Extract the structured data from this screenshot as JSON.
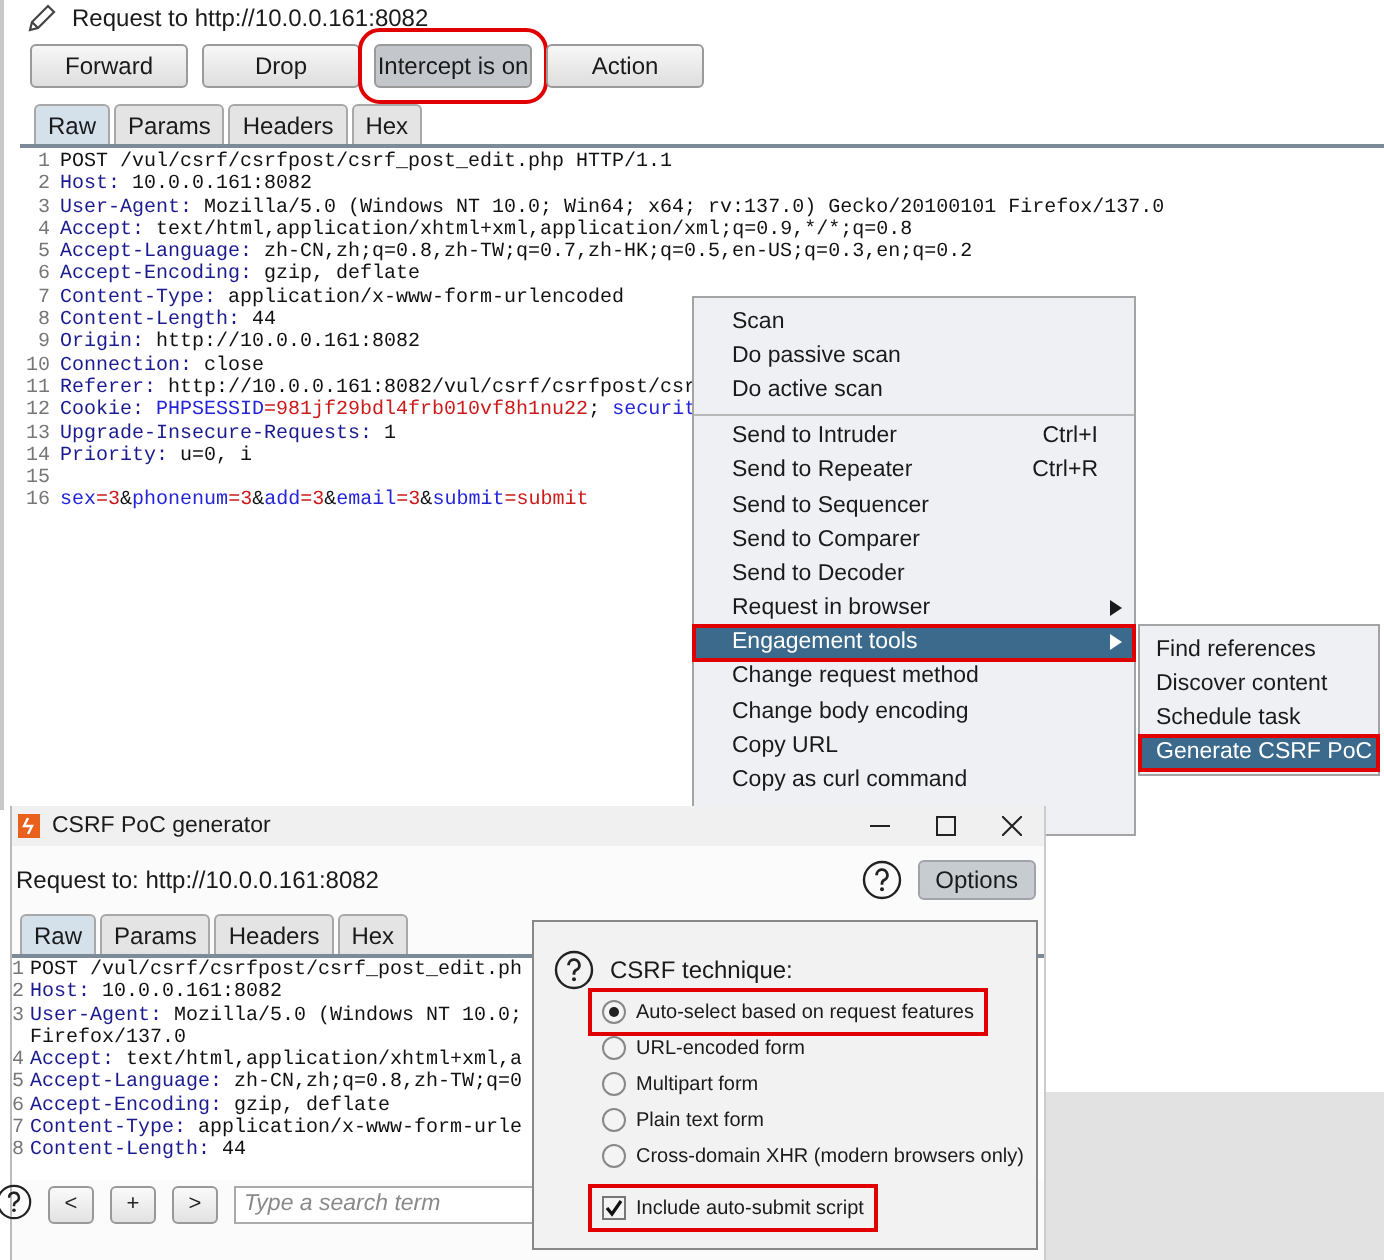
{
  "request_panel": {
    "title": "Request to http://10.0.0.161:8082",
    "buttons": [
      {
        "label": "Forward",
        "pressed": false,
        "annotated": false
      },
      {
        "label": "Drop",
        "pressed": false,
        "annotated": false
      },
      {
        "label": "Intercept is on",
        "pressed": true,
        "annotated": true
      },
      {
        "label": "Action",
        "pressed": false,
        "annotated": false
      }
    ],
    "tabs": [
      {
        "label": "Raw",
        "selected": true
      },
      {
        "label": "Params",
        "selected": false
      },
      {
        "label": "Headers",
        "selected": false
      },
      {
        "label": "Hex",
        "selected": false
      }
    ],
    "lines": [
      {
        "number": "1",
        "segments": [
          {
            "kind": "plain",
            "text": "POST /vul/csrf/csrfpost/csrf_post_edit.php HTTP/1.1"
          }
        ]
      },
      {
        "number": "2",
        "segments": [
          {
            "kind": "name",
            "text": "Host:"
          },
          {
            "kind": "plain",
            "text": " 10.0.0.161:8082"
          }
        ]
      },
      {
        "number": "3",
        "segments": [
          {
            "kind": "name",
            "text": "User-Agent:"
          },
          {
            "kind": "plain",
            "text": " Mozilla/5.0 (Windows NT 10.0; Win64; x64; rv:137.0) Gecko/20100101 Firefox/137.0"
          }
        ]
      },
      {
        "number": "4",
        "segments": [
          {
            "kind": "name",
            "text": "Accept:"
          },
          {
            "kind": "plain",
            "text": " text/html,application/xhtml+xml,application/xml;q=0.9,*/*;q=0.8"
          }
        ]
      },
      {
        "number": "5",
        "segments": [
          {
            "kind": "name",
            "text": "Accept-Language:"
          },
          {
            "kind": "plain",
            "text": " zh-CN,zh;q=0.8,zh-TW;q=0.7,zh-HK;q=0.5,en-US;q=0.3,en;q=0.2"
          }
        ]
      },
      {
        "number": "6",
        "segments": [
          {
            "kind": "name",
            "text": "Accept-Encoding:"
          },
          {
            "kind": "plain",
            "text": " gzip, deflate"
          }
        ]
      },
      {
        "number": "7",
        "segments": [
          {
            "kind": "name",
            "text": "Content-Type:"
          },
          {
            "kind": "plain",
            "text": " application/x-www-form-urlencoded"
          }
        ]
      },
      {
        "number": "8",
        "segments": [
          {
            "kind": "name",
            "text": "Content-Length:"
          },
          {
            "kind": "plain",
            "text": " 44"
          }
        ]
      },
      {
        "number": "9",
        "segments": [
          {
            "kind": "name",
            "text": "Origin:"
          },
          {
            "kind": "plain",
            "text": " http://10.0.0.161:8082"
          }
        ]
      },
      {
        "number": "10",
        "segments": [
          {
            "kind": "name",
            "text": "Connection:"
          },
          {
            "kind": "plain",
            "text": " close"
          }
        ]
      },
      {
        "number": "11",
        "segments": [
          {
            "kind": "name",
            "text": "Referer:"
          },
          {
            "kind": "plain",
            "text": " http://10.0.0.161:8082/vul/csrf/csrfpost/csr"
          }
        ]
      },
      {
        "number": "12",
        "segments": [
          {
            "kind": "name",
            "text": "Cookie: "
          },
          {
            "kind": "param",
            "text": "PHPSESSID"
          },
          {
            "kind": "value",
            "text": "=981jf29bdl4frb010vf8h1nu22"
          },
          {
            "kind": "plain",
            "text": "; "
          },
          {
            "kind": "param",
            "text": "securit"
          }
        ]
      },
      {
        "number": "13",
        "segments": [
          {
            "kind": "name",
            "text": "Upgrade-Insecure-Requests:"
          },
          {
            "kind": "plain",
            "text": " 1"
          }
        ]
      },
      {
        "number": "14",
        "segments": [
          {
            "kind": "name",
            "text": "Priority:"
          },
          {
            "kind": "plain",
            "text": " u=0, i"
          }
        ]
      },
      {
        "number": "15"
      },
      {
        "number": "16",
        "segments": [
          {
            "kind": "param",
            "text": "sex"
          },
          {
            "kind": "value",
            "text": "=3"
          },
          {
            "kind": "plain",
            "text": "&"
          },
          {
            "kind": "param",
            "text": "phonenum"
          },
          {
            "kind": "value",
            "text": "=3"
          },
          {
            "kind": "plain",
            "text": "&"
          },
          {
            "kind": "param",
            "text": "add"
          },
          {
            "kind": "value",
            "text": "=3"
          },
          {
            "kind": "plain",
            "text": "&"
          },
          {
            "kind": "param",
            "text": "email"
          },
          {
            "kind": "value",
            "text": "=3"
          },
          {
            "kind": "plain",
            "text": "&"
          },
          {
            "kind": "param",
            "text": "submit"
          },
          {
            "kind": "value",
            "text": "=submit"
          }
        ]
      }
    ]
  },
  "context_menu": {
    "items": [
      {
        "kind": "item",
        "label": "Scan",
        "has_submenu": false,
        "selected": false,
        "annotated": false
      },
      {
        "kind": "item",
        "label": "Do passive scan",
        "has_submenu": false,
        "selected": false,
        "annotated": false
      },
      {
        "kind": "item",
        "label": "Do active scan",
        "has_submenu": false,
        "selected": false,
        "annotated": false
      },
      {
        "kind": "separator"
      },
      {
        "kind": "item",
        "label": "Send to Intruder",
        "shortcut": "Ctrl+I",
        "has_submenu": false,
        "selected": false,
        "annotated": false
      },
      {
        "kind": "item",
        "label": "Send to Repeater",
        "shortcut": "Ctrl+R",
        "has_submenu": false,
        "selected": false,
        "annotated": false
      },
      {
        "kind": "item",
        "label": "Send to Sequencer",
        "has_submenu": false,
        "selected": false,
        "annotated": false
      },
      {
        "kind": "item",
        "label": "Send to Comparer",
        "has_submenu": false,
        "selected": false,
        "annotated": false
      },
      {
        "kind": "item",
        "label": "Send to Decoder",
        "has_submenu": false,
        "selected": false,
        "annotated": false
      },
      {
        "kind": "item",
        "label": "Request in browser",
        "has_submenu": true,
        "selected": false,
        "annotated": false
      },
      {
        "kind": "item",
        "label": "Engagement tools",
        "has_submenu": true,
        "selected": true,
        "annotated": true
      },
      {
        "kind": "item",
        "label": "Change request method",
        "has_submenu": false,
        "selected": false,
        "annotated": false
      },
      {
        "kind": "item",
        "label": "Change body encoding",
        "has_submenu": false,
        "selected": false,
        "annotated": false
      },
      {
        "kind": "item",
        "label": "Copy URL",
        "has_submenu": false,
        "selected": false,
        "annotated": false
      },
      {
        "kind": "item",
        "label": "Copy as curl command",
        "has_submenu": false,
        "selected": false,
        "annotated": false
      }
    ]
  },
  "submenu": {
    "items": [
      {
        "label": "Find references",
        "selected": false,
        "annotated": false
      },
      {
        "label": "Discover content",
        "selected": false,
        "annotated": false
      },
      {
        "label": "Schedule task",
        "selected": false,
        "annotated": false
      },
      {
        "label": "Generate CSRF PoC",
        "selected": true,
        "annotated": true
      }
    ]
  },
  "dialog": {
    "title": "CSRF PoC generator",
    "request_label": "Request to: http://10.0.0.161:8082",
    "options_button": "Options",
    "tabs": [
      {
        "label": "Raw",
        "selected": true
      },
      {
        "label": "Params",
        "selected": false
      },
      {
        "label": "Headers",
        "selected": false
      },
      {
        "label": "Hex",
        "selected": false
      }
    ],
    "lines": [
      {
        "number": "1",
        "segments": [
          {
            "kind": "plain",
            "text": "POST /vul/csrf/csrfpost/csrf_post_edit.ph"
          }
        ]
      },
      {
        "number": "2",
        "segments": [
          {
            "kind": "name",
            "text": "Host:"
          },
          {
            "kind": "plain",
            "text": " 10.0.0.161:8082"
          }
        ]
      },
      {
        "number": "3",
        "segments": [
          {
            "kind": "name",
            "text": "User-Agent:"
          },
          {
            "kind": "plain",
            "text": " Mozilla/5.0 (Windows NT 10.0;"
          }
        ]
      },
      {
        "segments": [
          {
            "kind": "plain",
            "text": "Firefox/137.0"
          }
        ]
      },
      {
        "number": "4",
        "segments": [
          {
            "kind": "name",
            "text": "Accept:"
          },
          {
            "kind": "plain",
            "text": " text/html,application/xhtml+xml,a"
          }
        ]
      },
      {
        "number": "5",
        "segments": [
          {
            "kind": "name",
            "text": "Accept-Language:"
          },
          {
            "kind": "plain",
            "text": " zh-CN,zh;q=0.8,zh-TW;q=0"
          }
        ]
      },
      {
        "number": "6",
        "segments": [
          {
            "kind": "name",
            "text": "Accept-Encoding:"
          },
          {
            "kind": "plain",
            "text": " gzip, deflate"
          }
        ]
      },
      {
        "number": "7",
        "segments": [
          {
            "kind": "name",
            "text": "Content-Type:"
          },
          {
            "kind": "plain",
            "text": " application/x-www-form-urle"
          }
        ]
      },
      {
        "number": "8",
        "segments": [
          {
            "kind": "name",
            "text": "Content-Length:"
          },
          {
            "kind": "plain",
            "text": " 44"
          }
        ]
      }
    ],
    "search": {
      "nav_buttons": [
        "<",
        "+",
        ">"
      ],
      "placeholder": "Type a search term"
    },
    "options_popup": {
      "heading": "CSRF technique:",
      "options": [
        {
          "kind": "radio",
          "label": "Auto-select based on request features",
          "selected": true,
          "annotated": true
        },
        {
          "kind": "radio",
          "label": "URL-encoded form",
          "selected": false,
          "annotated": false
        },
        {
          "kind": "radio",
          "label": "Multipart form",
          "selected": false,
          "annotated": false
        },
        {
          "kind": "radio",
          "label": "Plain text form",
          "selected": false,
          "annotated": false
        },
        {
          "kind": "radio",
          "label": "Cross-domain XHR (modern browsers only)",
          "selected": false,
          "annotated": false
        },
        {
          "kind": "checkbox",
          "label": "Include auto-submit script",
          "checked": true,
          "annotated": true
        }
      ]
    }
  }
}
